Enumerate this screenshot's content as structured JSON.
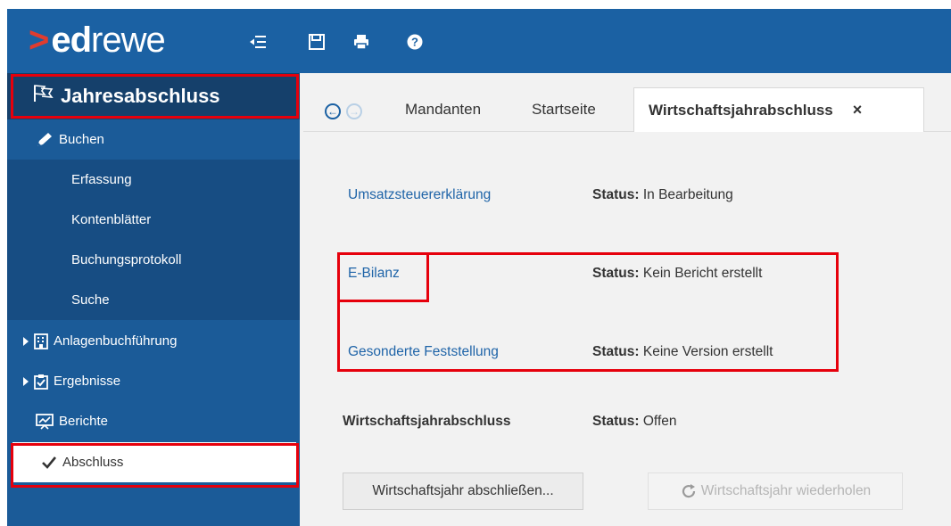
{
  "brand": {
    "prefix": ">",
    "bold": "ed",
    "rest": "rewe"
  },
  "toolbar": {
    "icons": [
      "outdent-icon",
      "save-icon",
      "print-icon",
      "help-icon"
    ]
  },
  "sidebar": {
    "title": "Jahresabschluss",
    "items": [
      {
        "label": "Buchen"
      },
      {
        "label": "Erfassung"
      },
      {
        "label": "Kontenblätter"
      },
      {
        "label": "Buchungsprotokoll"
      },
      {
        "label": "Suche"
      },
      {
        "label": "Anlagenbuchführung"
      },
      {
        "label": "Ergebnisse"
      },
      {
        "label": "Berichte"
      },
      {
        "label": "Abschluss"
      }
    ]
  },
  "tabs": [
    {
      "label": "Mandanten"
    },
    {
      "label": "Startseite"
    },
    {
      "label": "Wirtschaftsjahrabschluss",
      "active": true
    }
  ],
  "tab_close": "×",
  "rows": [
    {
      "label": "Umsatzsteuererklärung",
      "status_key": "Status:",
      "status_value": "In Bearbeitung"
    },
    {
      "label": "E-Bilanz",
      "status_key": "Status:",
      "status_value": "Kein Bericht erstellt"
    },
    {
      "label": "Gesonderte Feststellung",
      "status_key": "Status:",
      "status_value": "Keine Version erstellt"
    },
    {
      "label": "Wirtschaftsjahrabschluss",
      "status_key": "Status:",
      "status_value": "Offen"
    }
  ],
  "buttons": {
    "close_year": "Wirtschaftsjahr abschließen...",
    "repeat_year": "Wirtschaftsjahr wiederholen"
  },
  "colors": {
    "topbar": "#1b61a3",
    "sidebar": "#1b5b98",
    "link": "#1f64a8",
    "highlight": "#e6000c",
    "logo_accent": "#e03c2f"
  }
}
